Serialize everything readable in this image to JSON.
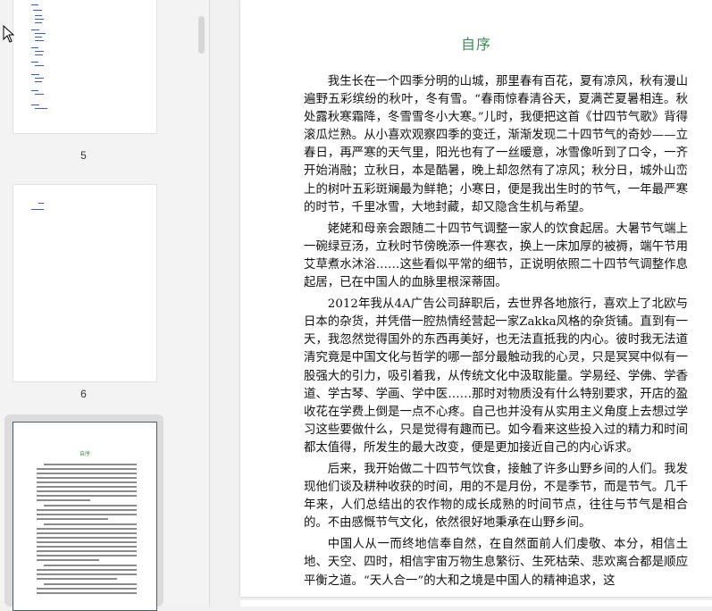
{
  "thumbnails": [
    {
      "label": "5"
    },
    {
      "label": "6"
    },
    {
      "label": "",
      "selected": true,
      "preview_title": "自序"
    }
  ],
  "document": {
    "title": "自序",
    "paragraphs": [
      "我生长在一个四季分明的山城，那里春有百花，夏有凉风，秋有漫山遍野五彩缤纷的秋叶，冬有雪。“春雨惊春清谷天，夏满芒夏暑相连。秋处露秋寒霜降，冬雪雪冬小大寒。”儿时，我便把这首《廿四节气歌》背得滚瓜烂熟。从小喜欢观察四季的变迁，渐渐发现二十四节气的奇妙——立春日，再严寒的天气里，阳光也有了一丝暖意，冰雪像听到了口令，一齐开始消融；立秋日，本是酷暑，晚上却忽然有了凉风；秋分日，城外山峦上的树叶五彩斑斓最为鲜艳；小寒日，便是我出生时的节气，一年最严寒的时节，千里冰雪，大地封藏，却又隐含生机与希望。",
      "姥姥和母亲会跟随二十四节气调整一家人的饮食起居。大暑节气端上一碗绿豆汤，立秋时节傍晚添一件寒衣，换上一床加厚的被褥，端午节用艾草煮水沐浴……这些看似平常的细节，正说明依照二十四节气调整作息起居，已在中国人的血脉里根深蒂固。",
      "2012年我从4A广告公司辞职后，去世界各地旅行，喜欢上了北欧与日本的杂货，并凭借一腔热情经营起一家Zakka风格的杂货铺。直到有一天，我忽然觉得国外的东西再美好，也无法直抵我的内心。彼时我无法道清究竟是中国文化与哲学的哪一部分最触动我的心灵，只是冥冥中似有一股强大的引力，吸引着我，从传统文化中汲取能量。学易经、学佛、学香道、学古琴、学画、学中医……那时对物质没有什么特别要求，开店的盈收花在学费上倒是一点不心疼。自己也并没有从实用主义角度上去想过学习这些要做什么，只是觉得有趣而已。如今看来这些投入过的精力和时间都太值得，所发生的最大改变，便是更加接近自己的内心诉求。",
      "后来，我开始做二十四节气饮食，接触了许多山野乡间的人们。我发现他们谈及耕种收获的时间，用的不是月份，不是季节，而是节气。几千年来，人们总结出的农作物的成长成熟的时间节点，往往与节气是相合的。不由感慨节气文化，依然很好地秉承在山野乡间。",
      "中国人从一而终地信奉自然，在自然面前人们虔敬、本分，相信土地、天空、四时，相信宇宙万物生息繁衍、生死枯荣、悲欢离合都是顺应平衡之道。“天人合一”的大和之境是中国人的精神追求，这"
    ]
  }
}
